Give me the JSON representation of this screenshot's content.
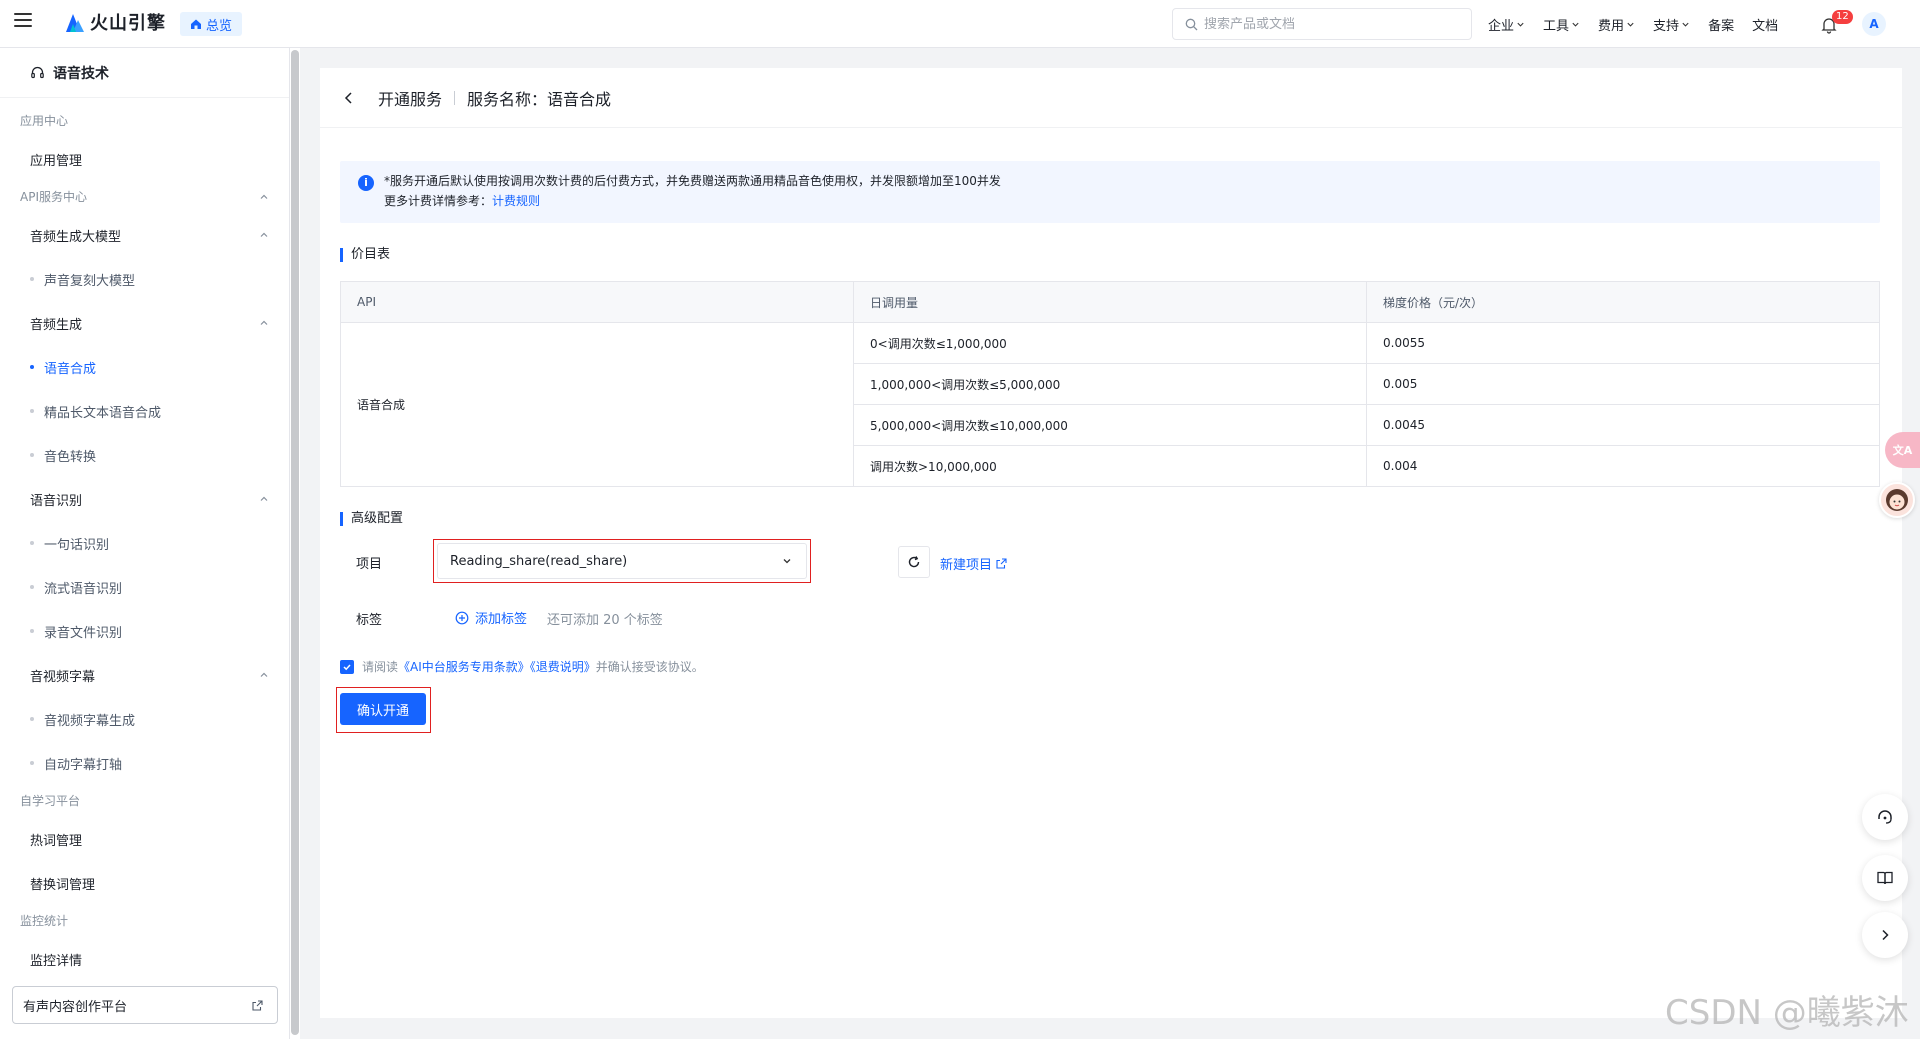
{
  "header": {
    "brand": "火山引擎",
    "home_label": "总览",
    "search_placeholder": "搜索产品或文档",
    "nav": [
      "企业",
      "工具",
      "费用",
      "支持",
      "备案",
      "文档"
    ],
    "notification_count": "12",
    "avatar_letter": "A"
  },
  "sidebar": {
    "title": "语音技术",
    "groups": {
      "app_center": "应用中心",
      "api_center": "API服务中心",
      "self_learning": "自学习平台",
      "monitor": "监控统计"
    },
    "items": {
      "app_manage": "应用管理",
      "audio_big_model": "音频生成大模型",
      "voice_clone": "声音复刻大模型",
      "audio_gen": "音频生成",
      "tts": "语音合成",
      "long_tts": "精品长文本语音合成",
      "voice_convert": "音色转换",
      "asr": "语音识别",
      "one_sentence": "一句话识别",
      "streaming": "流式语音识别",
      "file_asr": "录音文件识别",
      "subtitle": "音视频字幕",
      "subtitle_gen": "音视频字幕生成",
      "auto_subtitle": "自动字幕打轴",
      "hotword": "热词管理",
      "replace_word": "替换词管理",
      "monitor_detail": "监控详情"
    },
    "creator_platform": "有声内容创作平台"
  },
  "main": {
    "breadcrumb_open": "开通服务",
    "breadcrumb_name": "服务名称：语音合成",
    "notice_line1": "*服务开通后默认使用按调用次数计费的后付费方式，并免费赠送两款通用精品音色使用权，并发限额增加至100并发",
    "notice_line2_prefix": "更多计费详情参考：",
    "notice_link": "计费规则",
    "price_section": "价目表",
    "table": {
      "headers": [
        "API",
        "日调用量",
        "梯度价格（元/次）"
      ],
      "api_name": "语音合成",
      "rows": [
        {
          "range": "0<调用次数≤1,000,000",
          "price": "0.0055"
        },
        {
          "range": "1,000,000<调用次数≤5,000,000",
          "price": "0.005"
        },
        {
          "range": "5,000,000<调用次数≤10,000,000",
          "price": "0.0045"
        },
        {
          "range": "调用次数>10,000,000",
          "price": "0.004"
        }
      ]
    },
    "advanced_section": "高级配置",
    "project_label": "项目",
    "project_value": "Reading_share(read_share)",
    "new_project": "新建项目",
    "tag_label": "标签",
    "add_tag": "添加标签",
    "tag_hint": "还可添加 20 个标签",
    "agree_prefix": "请阅读",
    "agree_link1": "《AI中台服务专用条款》",
    "agree_link2": "《退费说明》",
    "agree_suffix": "并确认接受该协议。",
    "confirm_button": "确认开通"
  },
  "watermark": "CSDN @曦紫沐",
  "colors": {
    "accent": "#1664ff",
    "highlight_frame": "#e02020"
  }
}
